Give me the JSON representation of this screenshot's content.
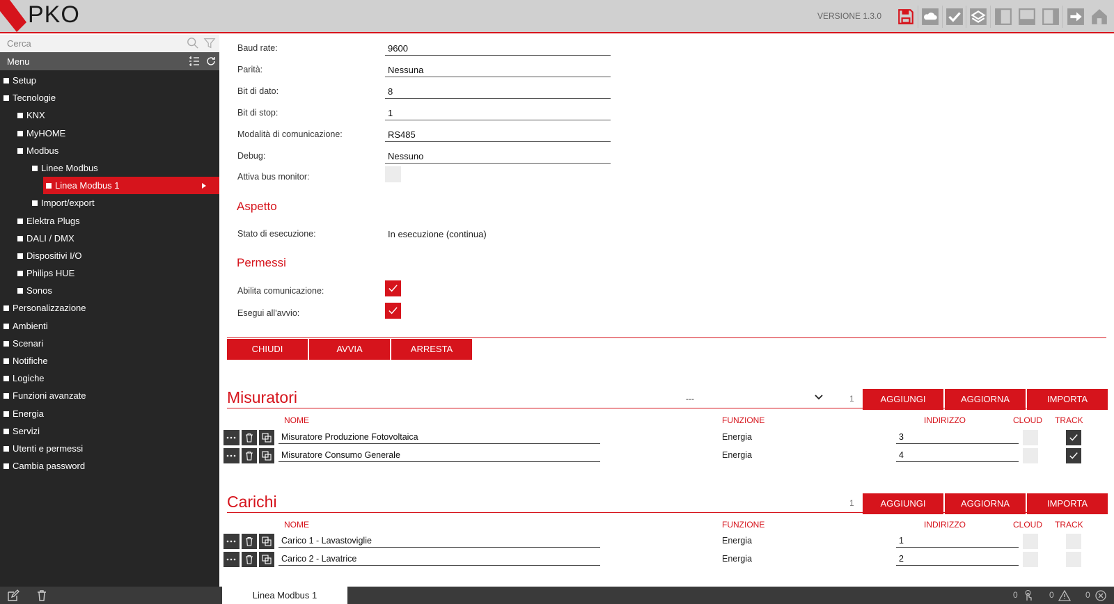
{
  "header": {
    "logo": "PKO",
    "version": "VERSIONE 1.3.0",
    "toolbar_icons": [
      "save-icon",
      "cloud-icon",
      "deploy-icon",
      "layers-icon",
      "panel-left-icon",
      "panel-bottom-icon",
      "panel-right-icon",
      "logout-icon",
      "home-icon"
    ]
  },
  "sidebar": {
    "search_placeholder": "Cerca",
    "menu_title": "Menu",
    "items": [
      {
        "label": "Setup",
        "level": 0
      },
      {
        "label": "Tecnologie",
        "level": 0
      },
      {
        "label": "KNX",
        "level": 1
      },
      {
        "label": "MyHOME",
        "level": 1
      },
      {
        "label": "Modbus",
        "level": 1
      },
      {
        "label": "Linee Modbus",
        "level": 2
      },
      {
        "label": "Linea Modbus 1",
        "level": 3,
        "selected": true
      },
      {
        "label": "Import/export",
        "level": 2
      },
      {
        "label": "Elektra Plugs",
        "level": 1
      },
      {
        "label": "DALI / DMX",
        "level": 1
      },
      {
        "label": "Dispositivi I/O",
        "level": 1
      },
      {
        "label": "Philips HUE",
        "level": 1
      },
      {
        "label": "Sonos",
        "level": 1
      },
      {
        "label": "Personalizzazione",
        "level": 0
      },
      {
        "label": "Ambienti",
        "level": 0
      },
      {
        "label": "Scenari",
        "level": 0
      },
      {
        "label": "Notifiche",
        "level": 0
      },
      {
        "label": "Logiche",
        "level": 0
      },
      {
        "label": "Funzioni avanzate",
        "level": 0
      },
      {
        "label": "Energia",
        "level": 0
      },
      {
        "label": "Servizi",
        "level": 0
      },
      {
        "label": "Utenti e permessi",
        "level": 0
      },
      {
        "label": "Cambia password",
        "level": 0
      }
    ]
  },
  "config": {
    "fields": [
      {
        "label": "Baud rate:",
        "value": "9600"
      },
      {
        "label": "Parità:",
        "value": "Nessuna"
      },
      {
        "label": "Bit di dato:",
        "value": "8"
      },
      {
        "label": "Bit di stop:",
        "value": "1"
      },
      {
        "label": "Modalità di comunicazione:",
        "value": "RS485"
      },
      {
        "label": "Debug:",
        "value": "Nessuno"
      }
    ],
    "bus_monitor_label": "Attiva bus monitor:",
    "bus_monitor_checked": false
  },
  "aspetto": {
    "title": "Aspetto",
    "status_label": "Stato di esecuzione:",
    "status_value": "In esecuzione (continua)"
  },
  "permessi": {
    "title": "Permessi",
    "enable_label": "Abilita comunicazione:",
    "enable_checked": true,
    "autostart_label": "Esegui all'avvio:",
    "autostart_checked": true
  },
  "actions": {
    "close": "CHIUDI",
    "start": "AVVIA",
    "stop": "ARRESTA"
  },
  "misuratori": {
    "title": "Misuratori",
    "select_value": "---",
    "count": "1",
    "add": "AGGIUNGI",
    "refresh": "AGGIORNA",
    "import": "IMPORTA",
    "columns": {
      "name": "NOME",
      "function": "FUNZIONE",
      "address": "INDIRIZZO",
      "cloud": "CLOUD",
      "track": "TRACK"
    },
    "rows": [
      {
        "name": "Misuratore Produzione Fotovoltaica",
        "function": "Energia",
        "address": "3",
        "cloud": false,
        "track": true
      },
      {
        "name": "Misuratore Consumo Generale",
        "function": "Energia",
        "address": "4",
        "cloud": false,
        "track": true
      }
    ]
  },
  "carichi": {
    "title": "Carichi",
    "count": "1",
    "add": "AGGIUNGI",
    "refresh": "AGGIORNA",
    "import": "IMPORTA",
    "columns": {
      "name": "NOME",
      "function": "FUNZIONE",
      "address": "INDIRIZZO",
      "cloud": "CLOUD",
      "track": "TRACK"
    },
    "rows": [
      {
        "name": "Carico 1 - Lavastoviglie",
        "function": "Energia",
        "address": "1",
        "cloud": false,
        "track": false
      },
      {
        "name": "Carico 2 - Lavatrice",
        "function": "Energia",
        "address": "2",
        "cloud": false,
        "track": false
      }
    ]
  },
  "footer": {
    "active_tab": "Linea Modbus 1",
    "counters": [
      "0",
      "0",
      "0"
    ]
  },
  "colors": {
    "accent": "#d6141c",
    "sidebar_bg": "#262626",
    "header_bg": "#d0d0d0"
  }
}
